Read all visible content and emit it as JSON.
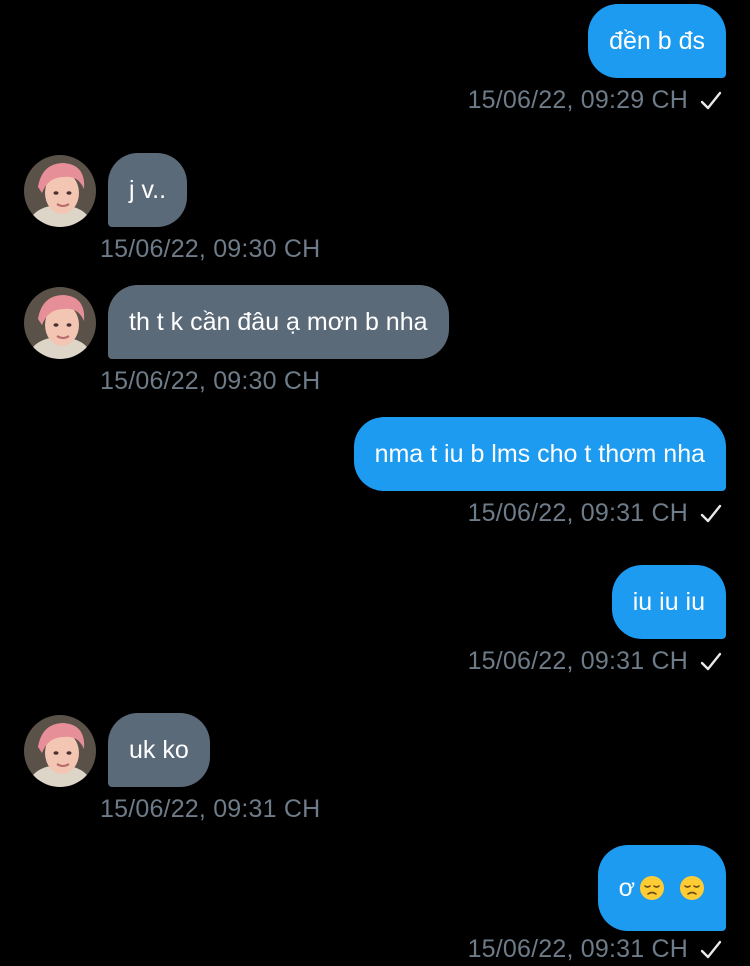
{
  "messages": [
    {
      "side": "sent",
      "text": "đền b đs",
      "time": "15/06/22, 09:29 CH"
    },
    {
      "side": "received",
      "text": "j v..",
      "time": "15/06/22, 09:30 CH"
    },
    {
      "side": "received",
      "text": "th t k cần đâu ạ mơn b nha",
      "time": "15/06/22, 09:30 CH"
    },
    {
      "side": "sent",
      "text": "nma t iu b lms cho t thơm nha",
      "time": "15/06/22, 09:31 CH"
    },
    {
      "side": "sent",
      "text": "iu iu iu",
      "time": "15/06/22, 09:31 CH"
    },
    {
      "side": "received",
      "text": "uk ko",
      "time": "15/06/22, 09:31 CH"
    },
    {
      "side": "sent",
      "text": "ơ",
      "emojis": [
        "disappointed-face-icon",
        "disappointed-face-icon"
      ],
      "time": "15/06/22, 09:31 CH"
    }
  ],
  "status_icon": "checkmark-icon",
  "colors": {
    "background": "#000000",
    "sent_bubble": "#1d9bf0",
    "received_bubble": "#5b6a79",
    "timestamp": "#6e7b88"
  }
}
